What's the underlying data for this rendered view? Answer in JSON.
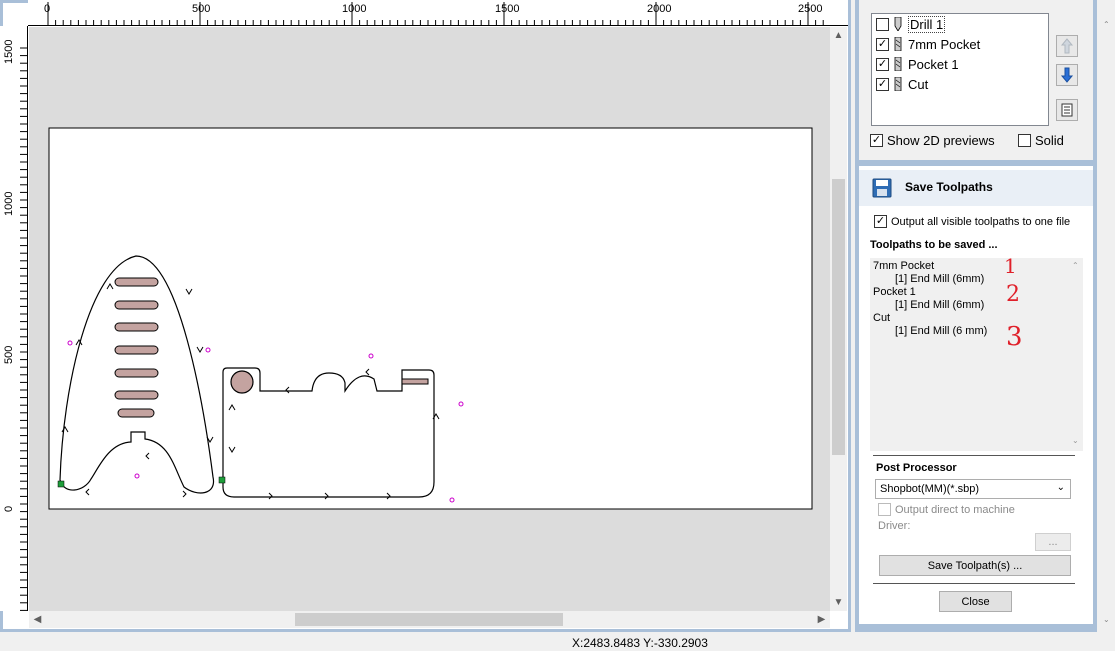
{
  "ruler_top_labels": [
    "0",
    "500",
    "1000",
    "1500",
    "2000",
    "2500"
  ],
  "ruler_left_labels": [
    "1500",
    "1000",
    "500",
    "0"
  ],
  "status": {
    "coords": "X:2483.8483 Y:-330.2903"
  },
  "toolpath_list": {
    "items": [
      {
        "label": "Drill 1",
        "checked": false
      },
      {
        "label": "7mm Pocket",
        "checked": true
      },
      {
        "label": "Pocket 1",
        "checked": true
      },
      {
        "label": "Cut",
        "checked": true
      }
    ],
    "show_2d_label": "Show 2D previews",
    "show_2d_checked": true,
    "solid_label": "Solid",
    "solid_checked": false
  },
  "save_panel": {
    "title": "Save Toolpaths",
    "output_all_label": "Output all visible toolpaths to one file",
    "output_all_checked": true,
    "to_be_saved_label": "Toolpaths to be saved ...",
    "entries": [
      {
        "name": "7mm Pocket",
        "tool": "[1] End Mill (6mm)",
        "annotation": "1"
      },
      {
        "name": "Pocket 1",
        "tool": "[1] End Mill (6mm)",
        "annotation": "2"
      },
      {
        "name": "Cut",
        "tool": "[1] End Mill (6 mm)",
        "annotation": "3"
      }
    ],
    "post_processor_label": "Post Processor",
    "post_processor_value": "Shopbot(MM)(*.sbp)",
    "output_direct_label": "Output direct to machine",
    "driver_label": "Driver:",
    "browse_label": "...",
    "save_button": "Save Toolpath(s) ...",
    "close_button": "Close"
  },
  "colors": {
    "annotation": "#e0202a",
    "frame": "#a9bfd8",
    "pocket_fill": "#c4a3a0",
    "marker": "#1e9e3a",
    "stray": "#cc00cc"
  }
}
